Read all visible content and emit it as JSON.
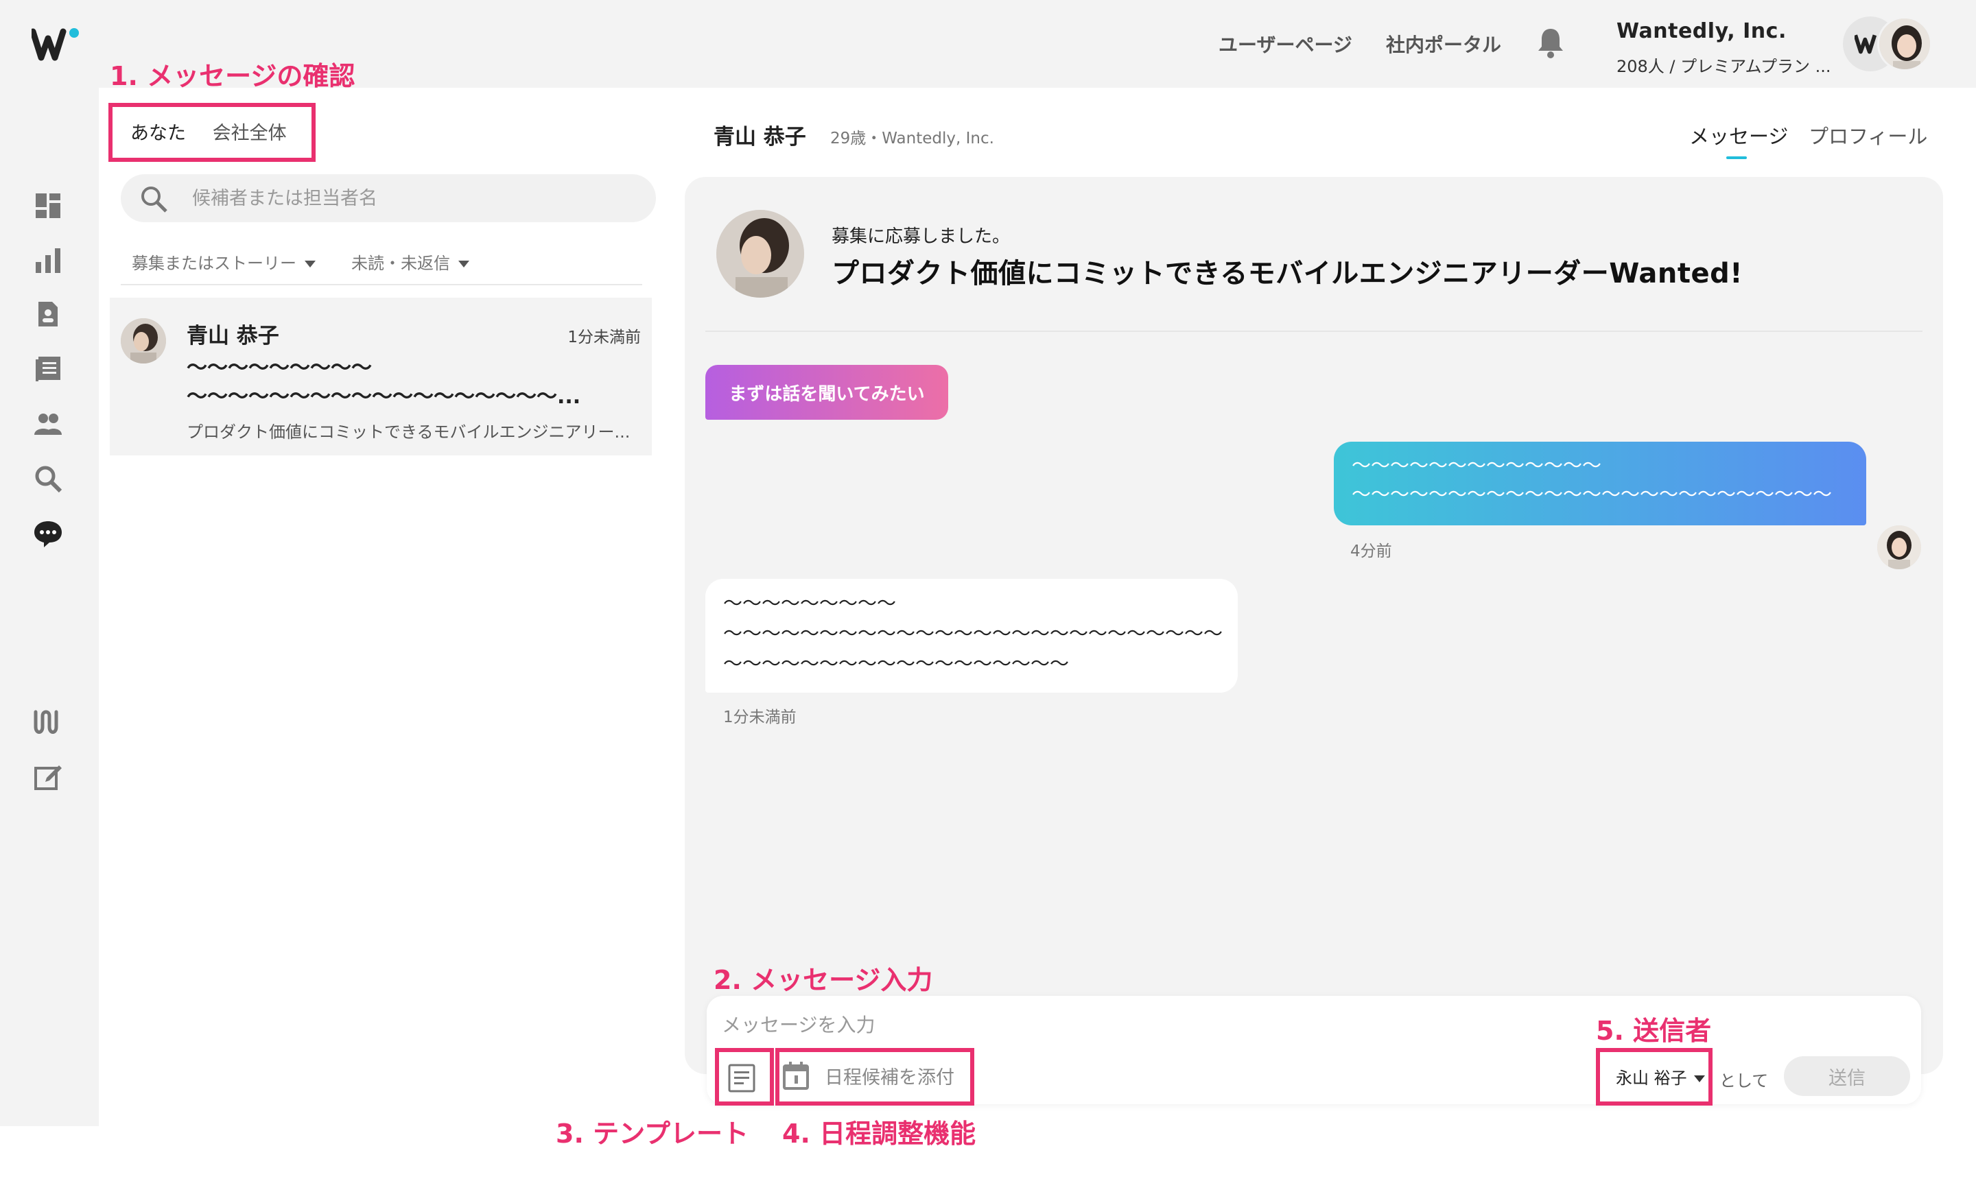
{
  "header": {
    "nav_user_page": "ユーザーページ",
    "nav_portal": "社内ポータル",
    "company_name": "Wantedly, Inc.",
    "company_plan": "208人 / プレミアムプラン ..."
  },
  "sidebar": {
    "icons": [
      "dashboard-icon",
      "analytics-icon",
      "applicant-icon",
      "stories-icon",
      "members-icon",
      "search-icon",
      "chat-icon",
      "wantedly-people-icon",
      "compose-icon"
    ]
  },
  "list": {
    "tab_you": "あなた",
    "tab_company": "会社全体",
    "search_placeholder": "候補者または担当者名",
    "filter_story": "募集またはストーリー",
    "filter_unread": "未読・未返信",
    "item": {
      "name": "青山 恭子",
      "time": "1分未満前",
      "line1": "〜〜〜〜〜〜〜〜〜",
      "line2": "〜〜〜〜〜〜〜〜〜〜〜〜〜〜〜〜〜〜...",
      "sub": "プロダクト価値にコミットできるモバイルエンジニアリー..."
    }
  },
  "conversation": {
    "name": "青山 恭子",
    "meta": "29歳・Wantedly, Inc.",
    "tab_message": "メッセージ",
    "tab_profile": "プロフィール",
    "applied_label": "募集に応募しました。",
    "job_title": "プロダクト価値にコミットできるモバイルエンジニアリーダーWanted!",
    "tag": "まずは話を聞いてみたい",
    "outgoing_line1": "〜〜〜〜〜〜〜〜〜〜〜〜〜",
    "outgoing_line2": "〜〜〜〜〜〜〜〜〜〜〜〜〜〜〜〜〜〜〜〜〜〜〜〜〜",
    "outgoing_time": "4分前",
    "incoming_line1": "〜〜〜〜〜〜〜〜〜",
    "incoming_line2": "〜〜〜〜〜〜〜〜〜〜〜〜〜〜〜〜〜〜〜〜〜〜〜〜〜〜",
    "incoming_line3": "〜〜〜〜〜〜〜〜〜〜〜〜〜〜〜〜〜〜",
    "incoming_time": "1分未満前"
  },
  "composer": {
    "placeholder": "メッセージを入力",
    "schedule_label": "日程候補を添付",
    "sender": "永山 裕子",
    "as_label": "として",
    "send_label": "送信"
  },
  "annotations": {
    "a1": "1. メッセージの確認",
    "a2": "2. メッセージ入力",
    "a3": "3. テンプレート",
    "a4": "4. 日程調整機能",
    "a5": "5. 送信者"
  },
  "colors": {
    "accent": "#21bddb",
    "annotation": "#e9306f",
    "tag_gradient_start": "#b65fe0",
    "tag_gradient_end": "#ec6fa7",
    "bubble_gradient_start": "#3ec5d8",
    "bubble_gradient_end": "#5b8ef0"
  }
}
